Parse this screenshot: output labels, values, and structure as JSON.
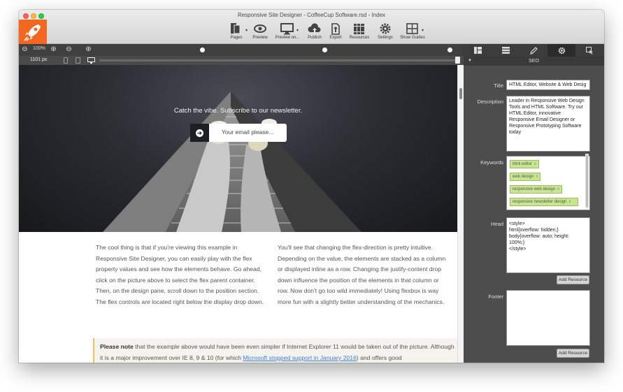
{
  "window": {
    "title": "Responsive Site Designer - CoffeeCup Software.rsd - Index"
  },
  "toolbar": {
    "items": [
      {
        "label": "Pages",
        "icon": "pages-icon"
      },
      {
        "label": "Preview",
        "icon": "eye-icon"
      },
      {
        "label": "Preview on...",
        "icon": "monitor-icon"
      },
      {
        "label": "Publish",
        "icon": "cloud-upload-icon"
      },
      {
        "label": "Export",
        "icon": "export-icon"
      },
      {
        "label": "Resources",
        "icon": "books-icon"
      },
      {
        "label": "Settings",
        "icon": "gear-icon"
      },
      {
        "label": "Show Guides",
        "icon": "guides-icon"
      }
    ]
  },
  "zoombar": {
    "zoom": "100%"
  },
  "widthbar": {
    "width_label": "1101 px"
  },
  "hero": {
    "tagline": "Catch the vibe. Subscribe to our newsletter.",
    "email_placeholder": "Your email please..."
  },
  "content": {
    "col1": "The cool thing is that if you're viewing this example in Responsive Site Designer, you can easily play with the flex property values and see how the elements behave. Go ahead, click on the picture above to select the flex parent container. Then, on the design pane, scroll down to the position section. The flex controls are located right below the display drop down.",
    "col2": "You'll see that changing the flex-direction is pretty intuitive. Depending on the value, the elements are stacked as a column or displayed inline as a row. Changing the justify-content drop down influence the position of the elements in that column or row. Now don't go too wild immediately! Using flexbox is way more fun with a slightly better understanding of the mechanics.",
    "note_bold": "Please note",
    "note_text1": " that the example above would have been even simpler if Internet Explorer 11 would be taken out of the picture. Although it is a major improvement over IE 8, 9 & 10 (for which ",
    "note_link": "Microsoft stopped support in January 2016",
    "note_text2": ") and offers good"
  },
  "side": {
    "section_title": "SEO",
    "title_label": "Title",
    "title_value": "HTML Editor, Website & Web Desig",
    "description_label": "Description",
    "description_value": "Leader in Responsive Web Design Tools and HTML Software. Try our HTML Editor, innovative Responsive Email Designer or Responsive Prototyping Software today",
    "keywords_label": "Keywords",
    "keywords": [
      "html editor",
      "web design",
      "responsive web design",
      "responsive newsletter design"
    ],
    "keyword_remove": "x",
    "head_label": "Head",
    "head_lines": [
      "<style>",
      "html{overflow: hidden;}",
      "body{overflow: auto; height:",
      "100%;}",
      "</style>"
    ],
    "add_resource": "Add Resource",
    "footer_label": "Footer"
  }
}
